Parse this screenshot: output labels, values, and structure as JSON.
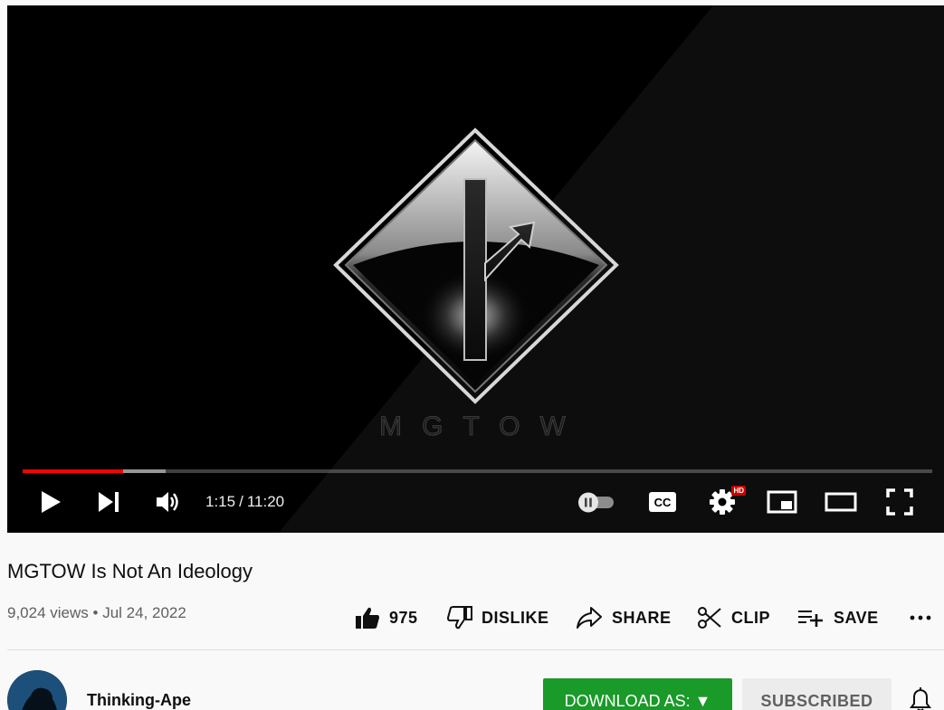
{
  "video": {
    "progress_played_fraction": 0.11,
    "progress_buffered_fraction": 0.157,
    "current_time": "1:15",
    "duration": "11:20",
    "time_separator": "/",
    "overlay_text": "MGTOW",
    "hd_badge": "HD",
    "controls": {
      "play_icon": "play-icon",
      "next_icon": "next-icon",
      "volume_icon": "volume-icon",
      "autoplay_icon": "autoplay-toggle-icon",
      "captions_icon": "captions-icon",
      "settings_icon": "gear-icon",
      "miniplayer_icon": "miniplayer-icon",
      "theater_icon": "theater-icon",
      "fullscreen_icon": "fullscreen-icon"
    }
  },
  "info": {
    "title": "MGTOW Is Not An Ideology",
    "views": "9,024 views",
    "dot": "•",
    "date": "Jul 24, 2022"
  },
  "actions": {
    "like_count": "975",
    "dislike_label": "DISLIKE",
    "share_label": "SHARE",
    "clip_label": "CLIP",
    "save_label": "SAVE"
  },
  "channel": {
    "name": "Thinking-Ape",
    "download_label": "DOWNLOAD AS: ▼",
    "subscribed_label": "SUBSCRIBED"
  },
  "colors": {
    "progress_red": "#ff0000",
    "download_green": "#1a9a29",
    "hd_red": "#cc0000"
  }
}
